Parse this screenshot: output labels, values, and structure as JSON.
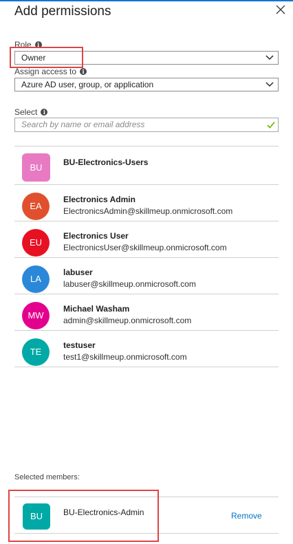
{
  "panel": {
    "title": "Add permissions",
    "close_icon": "close-icon"
  },
  "role": {
    "label": "Role",
    "value": "Owner"
  },
  "assign_access": {
    "label": "Assign access to",
    "value": "Azure AD user, group, or application"
  },
  "select": {
    "label": "Select",
    "placeholder": "Search by name or email address"
  },
  "colors": {
    "accent": "#0078d4",
    "highlight": "#e04343",
    "check": "#6bb700"
  },
  "members": [
    {
      "initials": "BU",
      "name": "BU-Electronics-Users",
      "email": "",
      "color": "#e87ac4",
      "shape": "square"
    },
    {
      "initials": "EA",
      "name": "Electronics Admin",
      "email": "ElectronicsAdmin@skillmeup.onmicrosoft.com",
      "color": "#e0502e",
      "shape": "circle"
    },
    {
      "initials": "EU",
      "name": "Electronics User",
      "email": "ElectronicsUser@skillmeup.onmicrosoft.com",
      "color": "#e81123",
      "shape": "circle"
    },
    {
      "initials": "LA",
      "name": "labuser",
      "email": "labuser@skillmeup.onmicrosoft.com",
      "color": "#2b88d8",
      "shape": "circle"
    },
    {
      "initials": "MW",
      "name": "Michael Washam",
      "email": "admin@skillmeup.onmicrosoft.com",
      "color": "#e3008c",
      "shape": "circle"
    },
    {
      "initials": "TE",
      "name": "testuser",
      "email": "test1@skillmeup.onmicrosoft.com",
      "color": "#00a9a5",
      "shape": "circle"
    }
  ],
  "selected": {
    "label": "Selected members:",
    "items": [
      {
        "initials": "BU",
        "name": "BU-Electronics-Admin",
        "action": "Remove",
        "color": "#00a9a5"
      }
    ]
  }
}
